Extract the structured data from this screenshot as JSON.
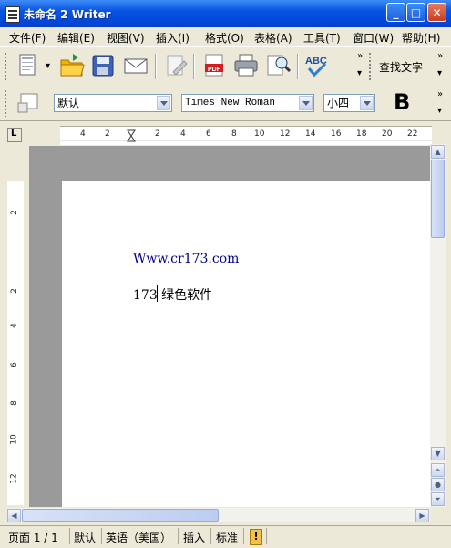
{
  "window": {
    "title": "未命名 2 Writer"
  },
  "window_buttons": [
    "_",
    "□",
    "✕"
  ],
  "menu": [
    "文件(F)",
    "编辑(E)",
    "视图(V)",
    "插入(I)",
    "格式(O)",
    "表格(A)",
    "工具(T)",
    "窗口(W)",
    "帮助(H)"
  ],
  "toolbar": {
    "find_text_label": "查找文字",
    "chevron": "»"
  },
  "format_bar": {
    "style_value": "默认",
    "font_value": "Times New Roman",
    "size_value": "小四",
    "bold_label": "B"
  },
  "ruler_h": {
    "ticks": [
      "4",
      "2",
      "2",
      "4",
      "6",
      "8",
      "10",
      "12",
      "14",
      "16",
      "18",
      "20",
      "22"
    ],
    "corner": "L"
  },
  "ruler_v": {
    "ticks": [
      "2",
      "2",
      "4",
      "6",
      "8",
      "10",
      "12"
    ]
  },
  "document": {
    "link_text": "Www.cr173.com",
    "body_text": "173 绿色软件"
  },
  "statusbar": {
    "page": "页面  1 / 1",
    "style": "默认",
    "language": "英语（美国）",
    "mode": "插入",
    "selection": "标准",
    "modified_icon": "!"
  },
  "colors": {
    "titlebar": "#0a54e3",
    "link": "#00008b",
    "chrome": "#ece9d8"
  }
}
